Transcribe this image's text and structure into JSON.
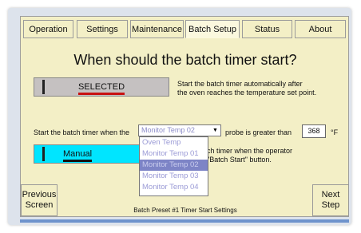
{
  "tabs": [
    {
      "label": "Operation"
    },
    {
      "label": "Settings"
    },
    {
      "label": "Maintenance"
    },
    {
      "label": "Batch Setup"
    },
    {
      "label": "Status"
    },
    {
      "label": "About"
    }
  ],
  "active_tab": "Batch Setup",
  "heading": "When should the batch timer start?",
  "option_auto": {
    "button_label": "SELECTED",
    "description_line1": "Start the batch timer automatically after",
    "description_line2": "the oven reaches the temperature set point."
  },
  "probe_row": {
    "prefix": "Start the batch timer when the",
    "selected_probe": "Monitor Temp 02",
    "middle": "probe is greater than",
    "temperature_value": "368",
    "unit": "°F"
  },
  "probe_options": [
    "Oven Temp",
    "Monitor Temp 01",
    "Monitor Temp 02",
    "Monitor Temp 03",
    "Monitor Temp 04"
  ],
  "highlighted_option": "Monitor Temp 02",
  "option_manual": {
    "button_label": "Manual",
    "description_line1": "ch timer when the operator",
    "description_line2": "\"Batch Start\" button."
  },
  "nav": {
    "previous_line1": "Previous",
    "previous_line2": "Screen",
    "next_line1": "Next",
    "next_line2": "Step"
  },
  "footer": "Batch Preset #1 Timer Start Settings",
  "colors": {
    "panel_bg": "#f3efc6",
    "selected_button_fill": "#c5c1c1",
    "manual_button_fill": "#00e5ff",
    "indicator_red": "#c81010",
    "dropdown_highlight": "#7d84c6",
    "dropdown_text": "#9b9bd6"
  }
}
